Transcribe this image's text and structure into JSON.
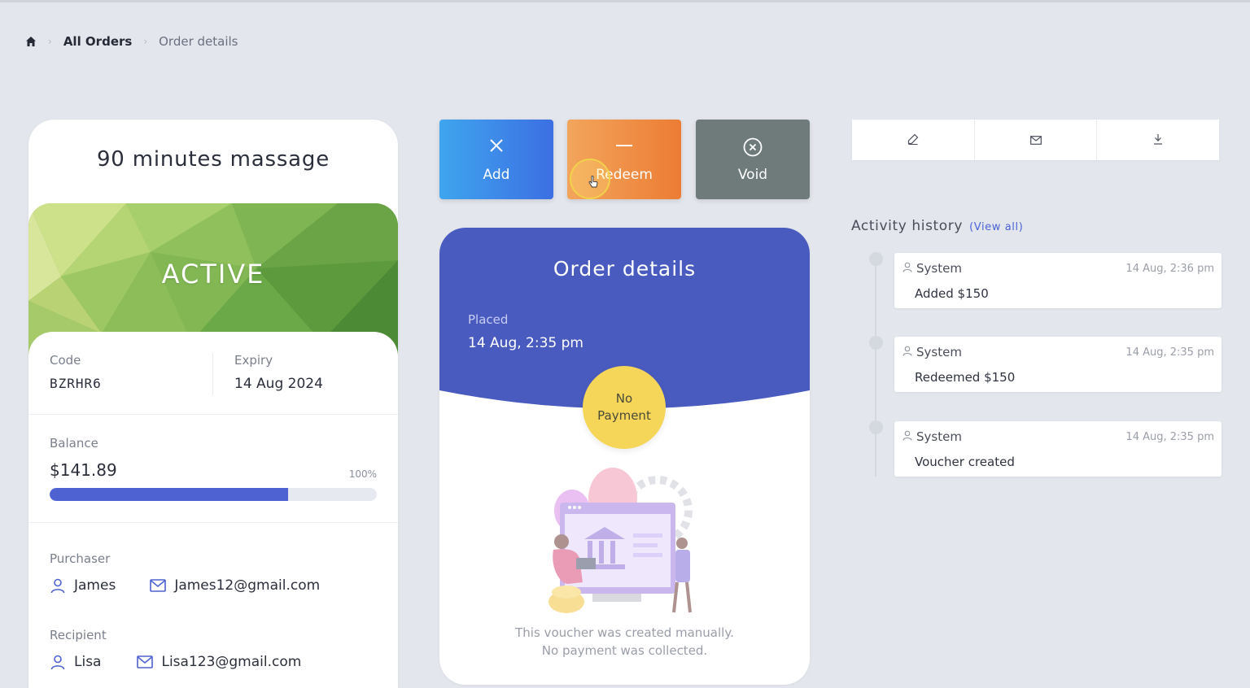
{
  "breadcrumb": {
    "home_icon": "home-icon",
    "items": [
      "All Orders",
      "Order details"
    ]
  },
  "voucher": {
    "title": "90 minutes massage",
    "status": "ACTIVE",
    "code_label": "Code",
    "code": "BZRHR6",
    "expiry_label": "Expiry",
    "expiry": "14 Aug 2024",
    "balance_label": "Balance",
    "balance": "$141.89",
    "balance_percent_label": "100%",
    "balance_fill_fraction": 0.73,
    "purchaser_label": "Purchaser",
    "purchaser_name": "James",
    "purchaser_email": "James12@gmail.com",
    "recipient_label": "Recipient",
    "recipient_name": "Lisa",
    "recipient_email": "Lisa123@gmail.com"
  },
  "actions": {
    "add_label": "Add",
    "redeem_label": "Redeem",
    "void_label": "Void"
  },
  "order": {
    "title": "Order details",
    "placed_label": "Placed",
    "placed_value": "14 Aug, 2:35 pm",
    "payment_status": "No Payment",
    "note_line1": "This voucher was created manually.",
    "note_line2": "No payment was collected."
  },
  "toolbar": {
    "icons": [
      "edit-icon",
      "mail-icon",
      "download-icon"
    ]
  },
  "activity": {
    "title": "Activity history",
    "view_all": "(View all)",
    "items": [
      {
        "user": "System",
        "time": "14 Aug, 2:36 pm",
        "message": "Added $150"
      },
      {
        "user": "System",
        "time": "14 Aug, 2:35 pm",
        "message": "Redeemed $150"
      },
      {
        "user": "System",
        "time": "14 Aug, 2:35 pm",
        "message": "Voucher created"
      }
    ]
  },
  "colors": {
    "primary": "#4e62d1",
    "order_header": "#4a5bbf",
    "add_button": "#3c6fe3",
    "redeem_button": "#ec7c34",
    "void_button": "#6f7a7b",
    "payment_badge": "#f5d658",
    "status_banner": "#7fb24a"
  }
}
